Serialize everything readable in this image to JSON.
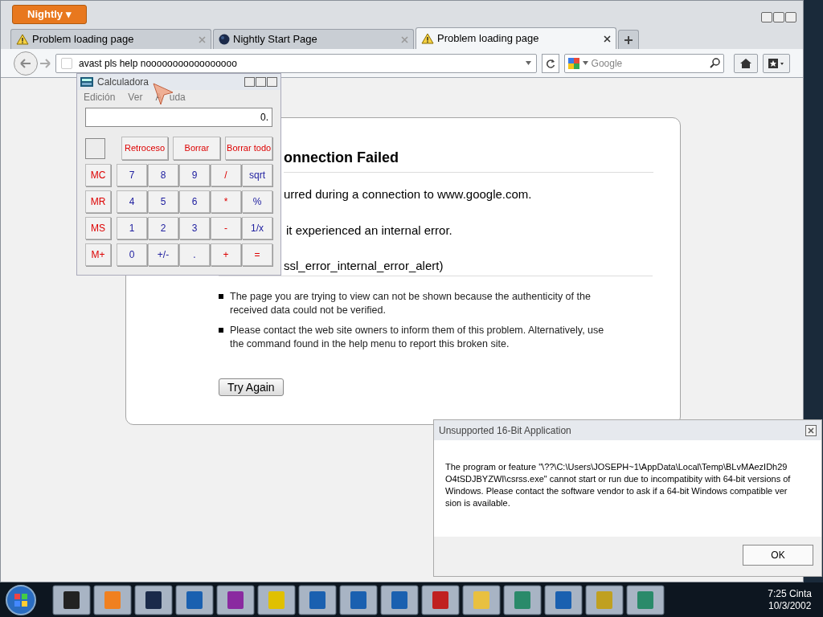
{
  "browser": {
    "app_button": "Nightly ▾",
    "tabs": [
      {
        "label": "Problem loading page",
        "selected": false
      },
      {
        "label": "Nightly Start Page",
        "selected": false
      },
      {
        "label": "Problem loading page",
        "selected": true
      }
    ],
    "address": "avast pls help nooooooooooooooooo",
    "search": {
      "placeholder": "Google"
    }
  },
  "error_page": {
    "title": "onnection Failed",
    "lines": [
      "urred during a connection to www.google.com.",
      "it experienced an internal error.",
      "ssl_error_internal_error_alert)"
    ],
    "bullets": [
      "The page you are trying to view can not be shown because the authenticity of the received data could not be verified.",
      "Please contact the web site owners to inform them of this problem. Alternatively, use the command found in the help menu to report this broken site."
    ],
    "button": "Try Again"
  },
  "calculator": {
    "title": "Calculadora",
    "menu": [
      "Edición",
      "Ver",
      "A   uda"
    ],
    "display": "0.",
    "top_keys": [
      "Retroceso",
      "Borrar",
      "Borrar todo"
    ],
    "keys": [
      [
        {
          "label": "MC",
          "kind": "memory"
        },
        {
          "label": "7",
          "kind": "digit"
        },
        {
          "label": "8",
          "kind": "digit"
        },
        {
          "label": "9",
          "kind": "digit"
        },
        {
          "label": "/",
          "kind": "operator"
        },
        {
          "label": "sqrt",
          "kind": "digit"
        }
      ],
      [
        {
          "label": "MR",
          "kind": "memory"
        },
        {
          "label": "4",
          "kind": "digit"
        },
        {
          "label": "5",
          "kind": "digit"
        },
        {
          "label": "6",
          "kind": "digit"
        },
        {
          "label": "*",
          "kind": "operator"
        },
        {
          "label": "%",
          "kind": "digit"
        }
      ],
      [
        {
          "label": "MS",
          "kind": "memory"
        },
        {
          "label": "1",
          "kind": "digit"
        },
        {
          "label": "2",
          "kind": "digit"
        },
        {
          "label": "3",
          "kind": "digit"
        },
        {
          "label": "-",
          "kind": "operator"
        },
        {
          "label": "1/x",
          "kind": "digit"
        }
      ],
      [
        {
          "label": "M+",
          "kind": "memory"
        },
        {
          "label": "0",
          "kind": "digit"
        },
        {
          "label": "+/-",
          "kind": "digit"
        },
        {
          "label": ".",
          "kind": "digit"
        },
        {
          "label": "+",
          "kind": "operator"
        },
        {
          "label": "=",
          "kind": "operator"
        }
      ]
    ]
  },
  "dialog": {
    "title": "Unsupported 16-Bit Application",
    "message": "The program or feature \"\\??\\C:\\Users\\JOSEPH~1\\AppData\\Local\\Temp\\BLvMAezIDh29O4tSDJBYZWI\\csrss.exe\" cannot start or run due to incompatibity with 64-bit versions of Windows. Please contact the software vendor to ask if a 64-bit Windows compatible version is available.",
    "button": "OK"
  },
  "taskbar": {
    "time": "7:25 Cinta",
    "date": "10/3/2002"
  }
}
